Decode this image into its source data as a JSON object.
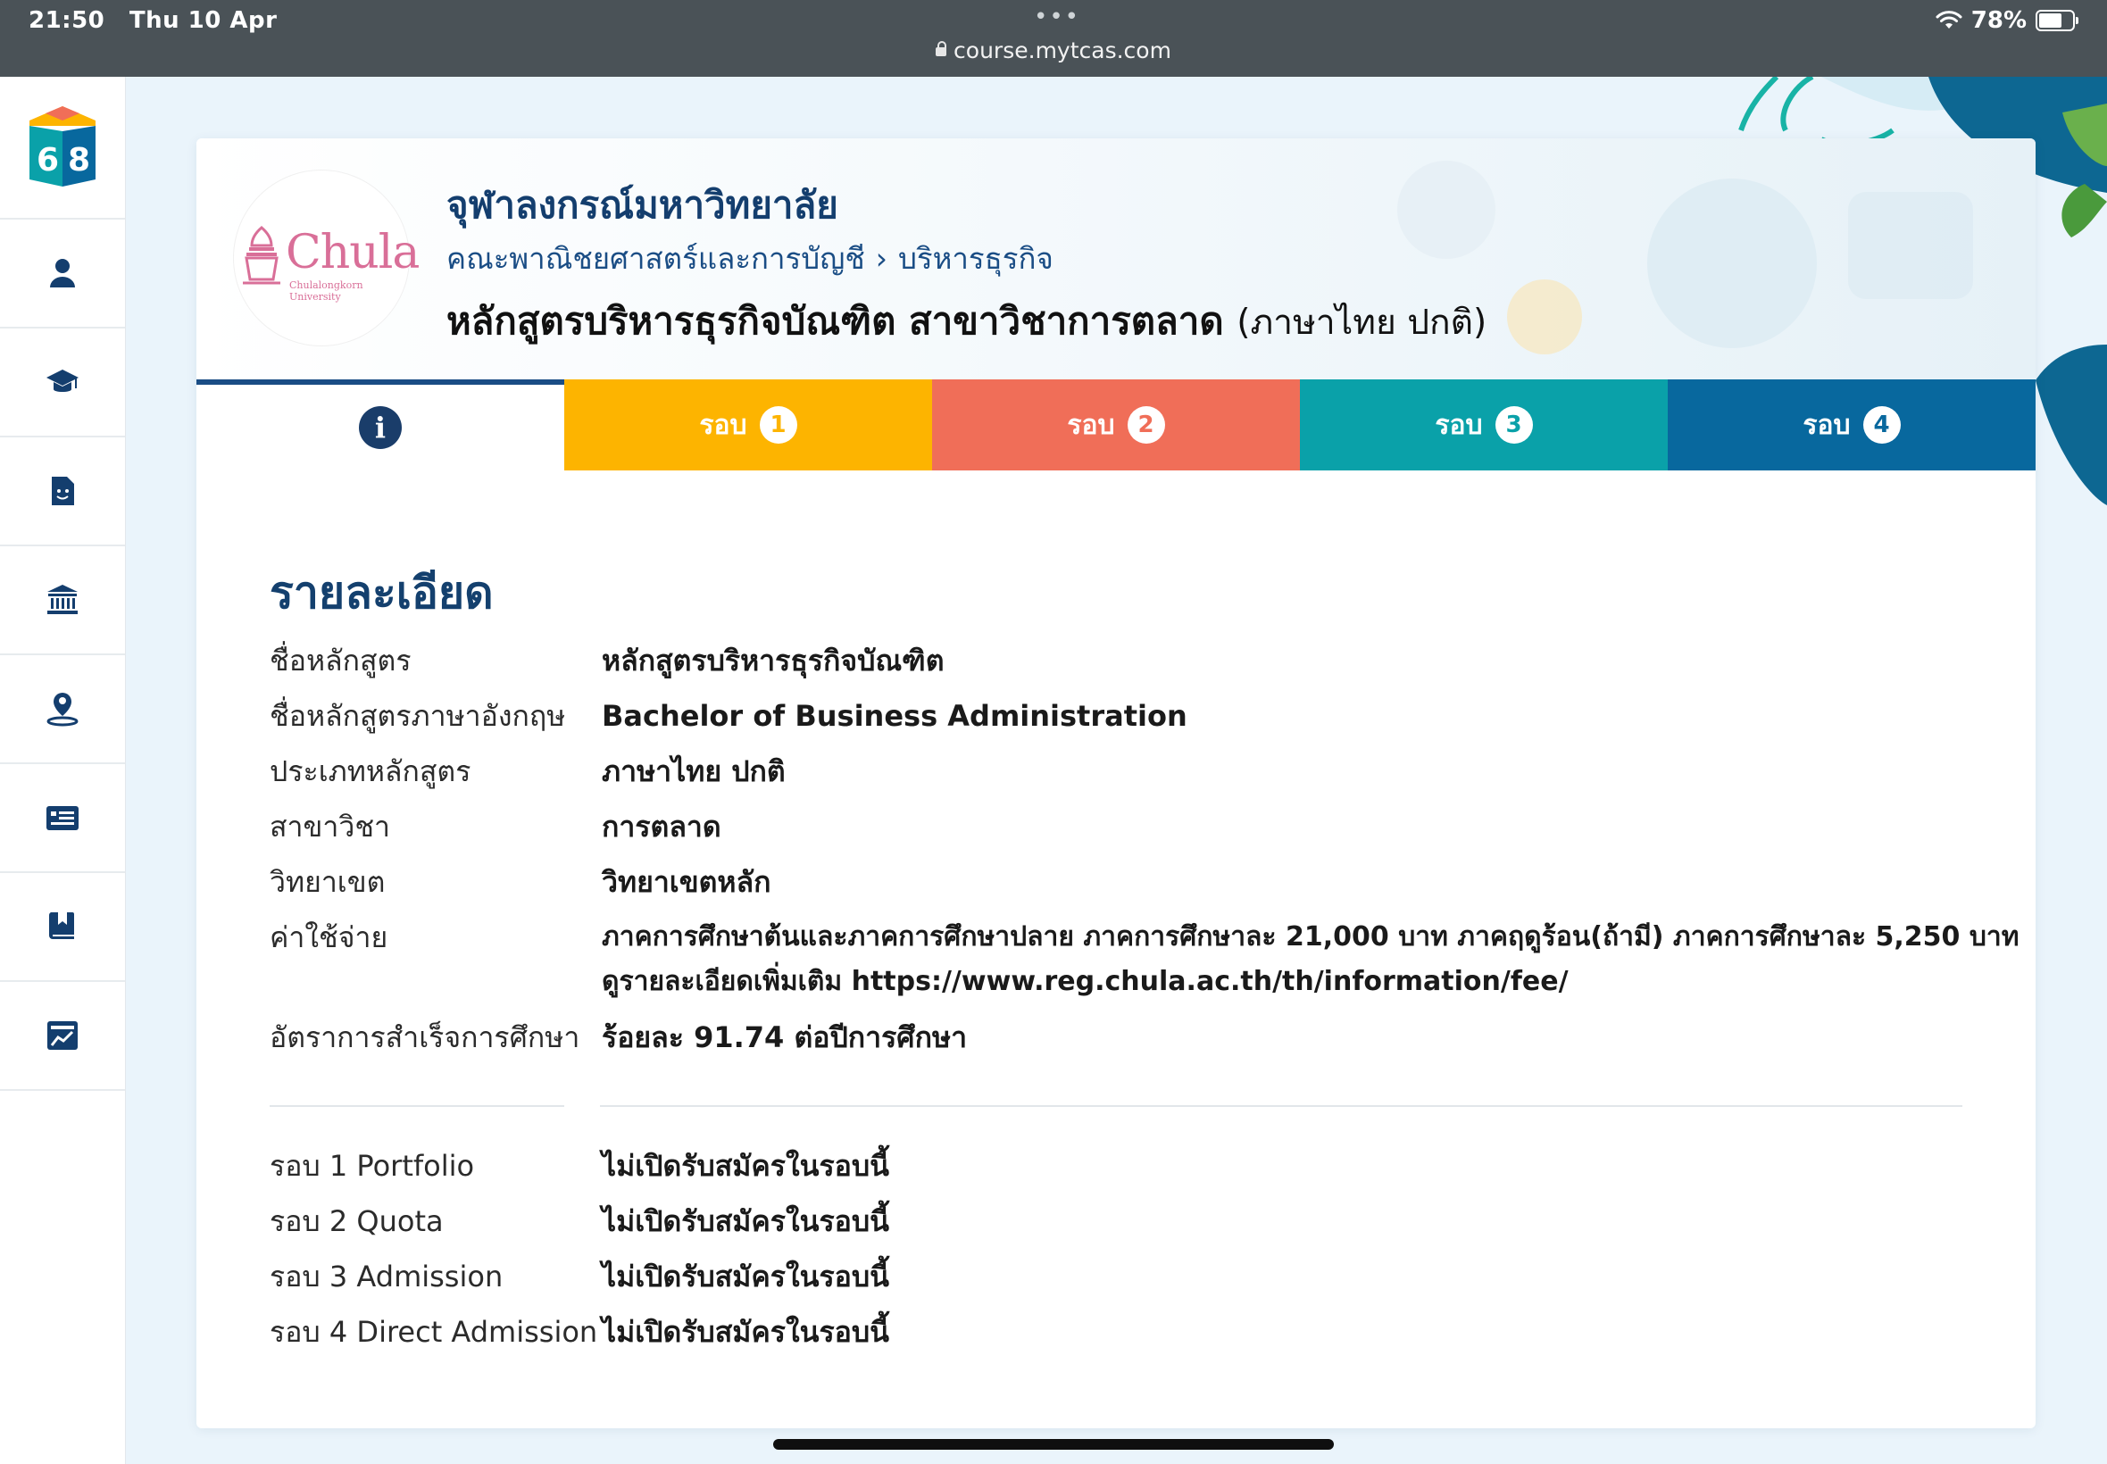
{
  "status_bar": {
    "time": "21:50",
    "date": "Thu 10 Apr",
    "url": "course.mytcas.com",
    "battery": "78%",
    "battery_level": 0.78
  },
  "sidebar": {
    "logo_digits": [
      "6",
      "8"
    ],
    "items": [
      {
        "icon": "user-icon"
      },
      {
        "icon": "graduation-cap-icon"
      },
      {
        "icon": "document-face-icon"
      },
      {
        "icon": "university-building-icon"
      },
      {
        "icon": "map-pin-person-icon"
      },
      {
        "icon": "list-newspaper-icon"
      },
      {
        "icon": "bookmark-book-icon"
      },
      {
        "icon": "chart-line-icon"
      }
    ]
  },
  "header": {
    "logo_word": "Chula",
    "logo_sub": "Chulalongkorn University",
    "university": "จุฬาลงกรณ์มหาวิทยาลัย",
    "faculty": "คณะพาณิชยศาสตร์และการบัญชี",
    "breadcrumb_sep": "›",
    "department": "บริหารธุรกิจ",
    "program": "หลักสูตรบริหารธุรกิจบัณฑิต สาขาวิชาการตลาด",
    "program_lang": "(ภาษาไทย ปกติ)"
  },
  "tabs": {
    "info_icon": "i",
    "rounds": [
      {
        "label": "รอบ",
        "num": "1"
      },
      {
        "label": "รอบ",
        "num": "2"
      },
      {
        "label": "รอบ",
        "num": "3"
      },
      {
        "label": "รอบ",
        "num": "4"
      }
    ]
  },
  "details": {
    "title": "รายละเอียด",
    "rows": [
      {
        "label": "ชื่อหลักสูตร",
        "value": "หลักสูตรบริหารธุรกิจบัณฑิต"
      },
      {
        "label": "ชื่อหลักสูตรภาษาอังกฤษ",
        "value": "Bachelor of Business Administration"
      },
      {
        "label": "ประเภทหลักสูตร",
        "value": "ภาษาไทย ปกติ"
      },
      {
        "label": "สาขาวิชา",
        "value": "การตลาด"
      },
      {
        "label": "วิทยาเขต",
        "value": "วิทยาเขตหลัก"
      },
      {
        "label": "ค่าใช้จ่าย",
        "value": "ภาคการศึกษาต้นและภาคการศึกษาปลาย ภาคการศึกษาละ 21,000 บาท ภาคฤดูร้อน(ถ้ามี) ภาคการศึกษาละ 5,250 บาท",
        "value2": "ดูรายละเอียดเพิ่มเติม https://www.reg.chula.ac.th/th/information/fee/"
      },
      {
        "label": "อัตราการสำเร็จการศึกษา",
        "value": "ร้อยละ 91.74 ต่อปีการศึกษา"
      }
    ],
    "rounds": [
      {
        "label": "รอบ 1 Portfolio",
        "value": "ไม่เปิดรับสมัครในรอบนี้"
      },
      {
        "label": "รอบ 2 Quota",
        "value": "ไม่เปิดรับสมัครในรอบนี้"
      },
      {
        "label": "รอบ 3 Admission",
        "value": "ไม่เปิดรับสมัครในรอบนี้"
      },
      {
        "label": "รอบ 4 Direct Admission",
        "value": "ไม่เปิดรับสมัครในรอบนี้"
      }
    ]
  },
  "colors": {
    "round1": "#fdb400",
    "round2": "#f06e58",
    "round3": "#0aa1a9",
    "round4": "#08689e",
    "primary": "#1a4d85"
  }
}
